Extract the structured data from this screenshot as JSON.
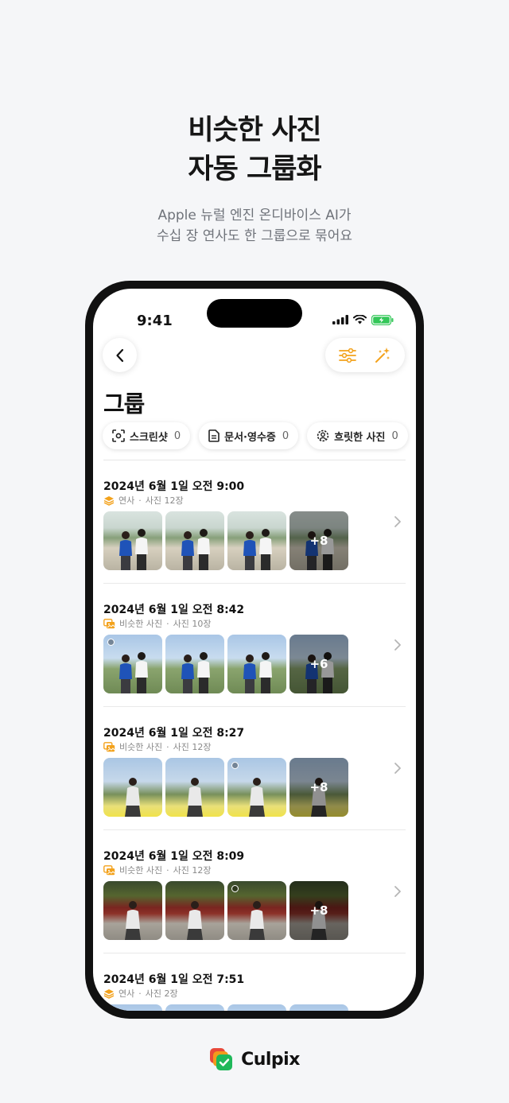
{
  "hero": {
    "title_line1": "비슷한 사진",
    "title_line2": "자동 그룹화",
    "subtitle_line1": "Apple 뉴럴 엔진 온디바이스 AI가",
    "subtitle_line2": "수십 장 연사도 한 그룹으로 묶어요"
  },
  "status_bar": {
    "time": "9:41",
    "icons": [
      "signal-icon",
      "wifi-icon",
      "battery-charging-icon"
    ]
  },
  "nav": {
    "back_icon": "chevron-left-icon",
    "tools": [
      "sliders-icon",
      "magic-wand-icon"
    ]
  },
  "page": {
    "title": "그룹"
  },
  "chips": [
    {
      "icon": "screenshot-icon",
      "label": "스크린샷",
      "count": "0"
    },
    {
      "icon": "document-icon",
      "label": "문서·영수증",
      "count": "0"
    },
    {
      "icon": "blur-icon",
      "label": "흐릿한 사진",
      "count": "0"
    }
  ],
  "groups": [
    {
      "date": "2024년 6월 1일 오전 9:00",
      "type": "연사",
      "type_icon": "layers-icon",
      "count": "사진 12장",
      "more": "+8",
      "scene": "park"
    },
    {
      "date": "2024년 6월 1일 오전 8:42",
      "type": "비슷한 사진",
      "type_icon": "similar-photos-icon",
      "count": "사진 10장",
      "more": "+6",
      "scene": "sky"
    },
    {
      "date": "2024년 6월 1일 오전 8:27",
      "type": "비슷한 사진",
      "type_icon": "similar-photos-icon",
      "count": "사진 12장",
      "more": "+8",
      "scene": "yellow"
    },
    {
      "date": "2024년 6월 1일 오전 8:09",
      "type": "비슷한 사진",
      "type_icon": "similar-photos-icon",
      "count": "사진 12장",
      "more": "+8",
      "scene": "temple"
    },
    {
      "date": "2024년 6월 1일 오전 7:51",
      "type": "연사",
      "type_icon": "layers-icon",
      "count": "사진 2장",
      "more": "",
      "scene": "sky"
    }
  ],
  "separator": "·",
  "brand": {
    "name": "Culpix",
    "logo": "culpix-logo-icon"
  },
  "colors": {
    "accent": "#f3a21c",
    "background": "#f5f6f8",
    "battery_green": "#34c759"
  }
}
